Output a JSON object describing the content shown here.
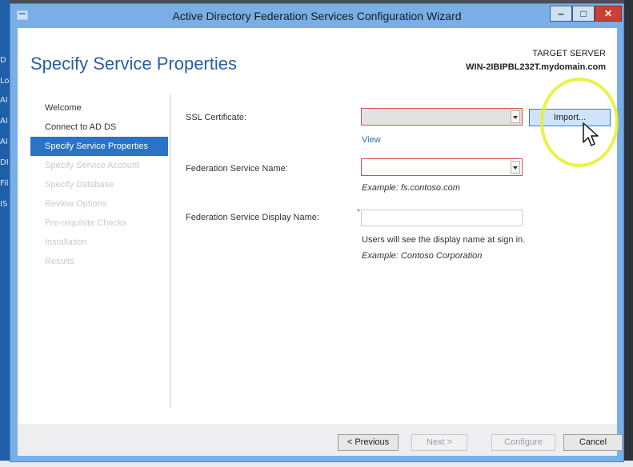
{
  "window": {
    "title": "Active Directory Federation Services Configuration Wizard",
    "controls": {
      "minimize": "‒",
      "maximize": "□",
      "close": "✕"
    }
  },
  "header": {
    "heading": "Specify Service Properties",
    "target_server_label": "TARGET SERVER",
    "target_server_value": "WIN-2IBIPBL232T.mydomain.com"
  },
  "nav": {
    "items": [
      {
        "label": "Welcome",
        "state": "normal"
      },
      {
        "label": "Connect to AD DS",
        "state": "normal"
      },
      {
        "label": "Specify Service Properties",
        "state": "active"
      },
      {
        "label": "Specify Service Account",
        "state": "disabled"
      },
      {
        "label": "Specify Database",
        "state": "disabled"
      },
      {
        "label": "Review Options",
        "state": "disabled"
      },
      {
        "label": "Pre-requisite Checks",
        "state": "disabled"
      },
      {
        "label": "Installation",
        "state": "disabled"
      },
      {
        "label": "Results",
        "state": "disabled"
      }
    ]
  },
  "form": {
    "ssl_certificate": {
      "label": "SSL Certificate:",
      "value": "",
      "import_label": "Import...",
      "view_label": "View"
    },
    "federation_service_name": {
      "label": "Federation Service Name:",
      "value": "",
      "example": "Example: fs.contoso.com"
    },
    "federation_service_display_name": {
      "label": "Federation Service Display Name:",
      "required_mark": "*",
      "value": "",
      "note": "Users will see the display name at sign in.",
      "example": "Example: Contoso Corporation"
    }
  },
  "footer": {
    "previous_label": "< Previous",
    "next_label": "Next >",
    "configure_label": "Configure",
    "cancel_label": "Cancel"
  },
  "background": {
    "left_strip_letters": [
      "D",
      "Lo",
      "AI",
      "AI",
      "AI",
      "DI",
      "Fil",
      "IS"
    ]
  },
  "colors": {
    "accent": "#2a73c5",
    "heading": "#2b5ea0",
    "window_frame": "#7aaee6",
    "error_border": "#d4534d",
    "highlight": "#e6f028"
  }
}
